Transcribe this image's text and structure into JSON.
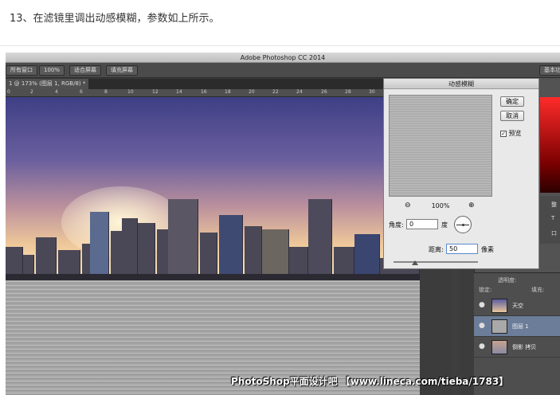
{
  "article": {
    "step_caption": "13、在滤镜里调出动感模糊，参数如上所示。"
  },
  "app": {
    "window_title": "Adobe Photoshop CC 2014",
    "options_bar": {
      "all_windows": "所有窗口",
      "zoom_100": "100%",
      "fit_screen": "适合屏幕",
      "fill_screen": "填充屏幕",
      "workspace": "基本功"
    },
    "document_tab": "1 @ 173% (图层 1, RGB/8) *",
    "ruler_ticks": [
      "0",
      "2",
      "4",
      "6",
      "8",
      "10",
      "12",
      "14",
      "16",
      "18",
      "20",
      "22",
      "24",
      "26",
      "28",
      "30"
    ]
  },
  "dialog": {
    "title": "动感模糊",
    "ok_label": "确定",
    "cancel_label": "取消",
    "preview_label": "预览",
    "preview_checked": true,
    "zoom_value": "100%",
    "angle_label": "角度:",
    "angle_value": "0",
    "angle_unit": "度",
    "distance_label": "距离:",
    "distance_value": "50",
    "distance_unit": "像素",
    "distance_slider_fraction": 0.25
  },
  "side_panel": {
    "color_ramp_top": "#ff2b2b",
    "tool_labels": [
      "整",
      "T",
      "口"
    ],
    "opacity_label": "透明度:",
    "fill_label": "填充:",
    "lock_label": "锁定:"
  },
  "layers": [
    {
      "name": "天空",
      "selected": false
    },
    {
      "name": "图层 1",
      "selected": true
    },
    {
      "name": "倒影 拷贝",
      "selected": false
    }
  ],
  "watermark": "PhotoShop平面设计吧 【www.lineca.com/tieba/1783】"
}
